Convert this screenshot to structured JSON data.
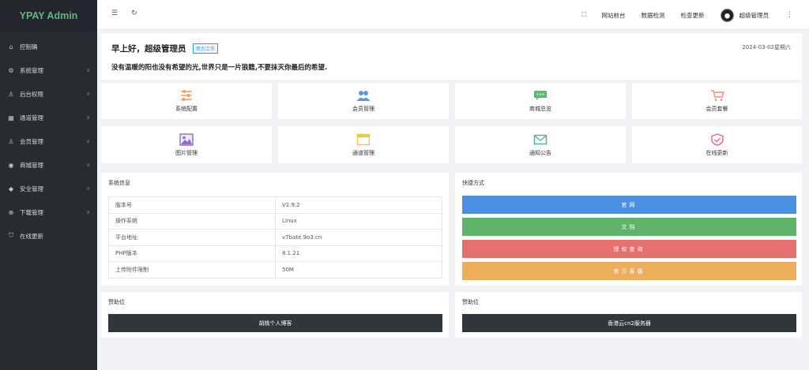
{
  "brand": "YPAY Admin",
  "sidebar": {
    "items": [
      {
        "label": "控制确",
        "icon": "home-icon",
        "glyph": "⌂",
        "has_children": false
      },
      {
        "label": "系统管理",
        "icon": "gear-icon",
        "glyph": "⚙",
        "has_children": true
      },
      {
        "label": "后台权限",
        "icon": "user-icon",
        "glyph": "♙",
        "has_children": true
      },
      {
        "label": "通道管理",
        "icon": "grid-icon",
        "glyph": "▦",
        "has_children": true
      },
      {
        "label": "会员管理",
        "icon": "user-icon",
        "glyph": "♙",
        "has_children": true
      },
      {
        "label": "商城管理",
        "icon": "shop-icon",
        "glyph": "◉",
        "has_children": true
      },
      {
        "label": "安全管理",
        "icon": "diamond-icon",
        "glyph": "◆",
        "has_children": true
      },
      {
        "label": "下载管理",
        "icon": "download-icon",
        "glyph": "⊕",
        "has_children": true
      },
      {
        "label": "在线更新",
        "icon": "shield-icon",
        "glyph": "⛉",
        "has_children": false
      }
    ]
  },
  "header": {
    "menu_icon": "☰",
    "refresh_icon": "↻",
    "fullscreen_icon": "⛶",
    "links": [
      "网站前台",
      "数据检测",
      "检查更新"
    ],
    "username": "超级管理员",
    "more_icon": "⋮"
  },
  "welcome": {
    "greeting": "早上好，超级管理员",
    "tag": "努力工作",
    "date": "2024-03-02星期六",
    "motto": "没有温暖的阳也没有希望的光,世界只是一片狼籍,不要抹灭你最后的希望."
  },
  "tiles": [
    {
      "label": "系统配置",
      "icon": "sliders-icon",
      "color": "#f5a35c"
    },
    {
      "label": "会员管理",
      "icon": "users-icon",
      "color": "#5b9bd5"
    },
    {
      "label": "商城总览",
      "icon": "chat-icon",
      "color": "#5fb878"
    },
    {
      "label": "会员套餐",
      "icon": "cart-icon",
      "color": "#f28b82"
    },
    {
      "label": "图片管理",
      "icon": "image-icon",
      "color": "#8e6cc8"
    },
    {
      "label": "通道管理",
      "icon": "window-icon",
      "color": "#f5c242"
    },
    {
      "label": "通知公告",
      "icon": "mail-icon",
      "color": "#4caf91"
    },
    {
      "label": "在线更新",
      "icon": "shield-check-icon",
      "color": "#e8618c"
    }
  ],
  "system_info": {
    "title": "系统信息",
    "rows": [
      {
        "key": "版本号",
        "value": "V2.9.2"
      },
      {
        "key": "操作系统",
        "value": "Linux"
      },
      {
        "key": "平台地址",
        "value": "v7bate.9o3.cn"
      },
      {
        "key": "PHP版本",
        "value": "8.1.21"
      },
      {
        "key": "上传附件限制",
        "value": "50M"
      }
    ]
  },
  "shortcuts": {
    "title": "快捷方式",
    "buttons": [
      {
        "label": "官网",
        "color": "#4a90e2"
      },
      {
        "label": "文档",
        "color": "#5fb36b"
      },
      {
        "label": "授权查询",
        "color": "#e5706c"
      },
      {
        "label": "官方客服",
        "color": "#ecad5c"
      }
    ]
  },
  "sponsor_left": {
    "title": "赞助位",
    "button": "胡桃个人博客"
  },
  "sponsor_right": {
    "title": "赞助位",
    "button": "香港云cn2服务器"
  }
}
